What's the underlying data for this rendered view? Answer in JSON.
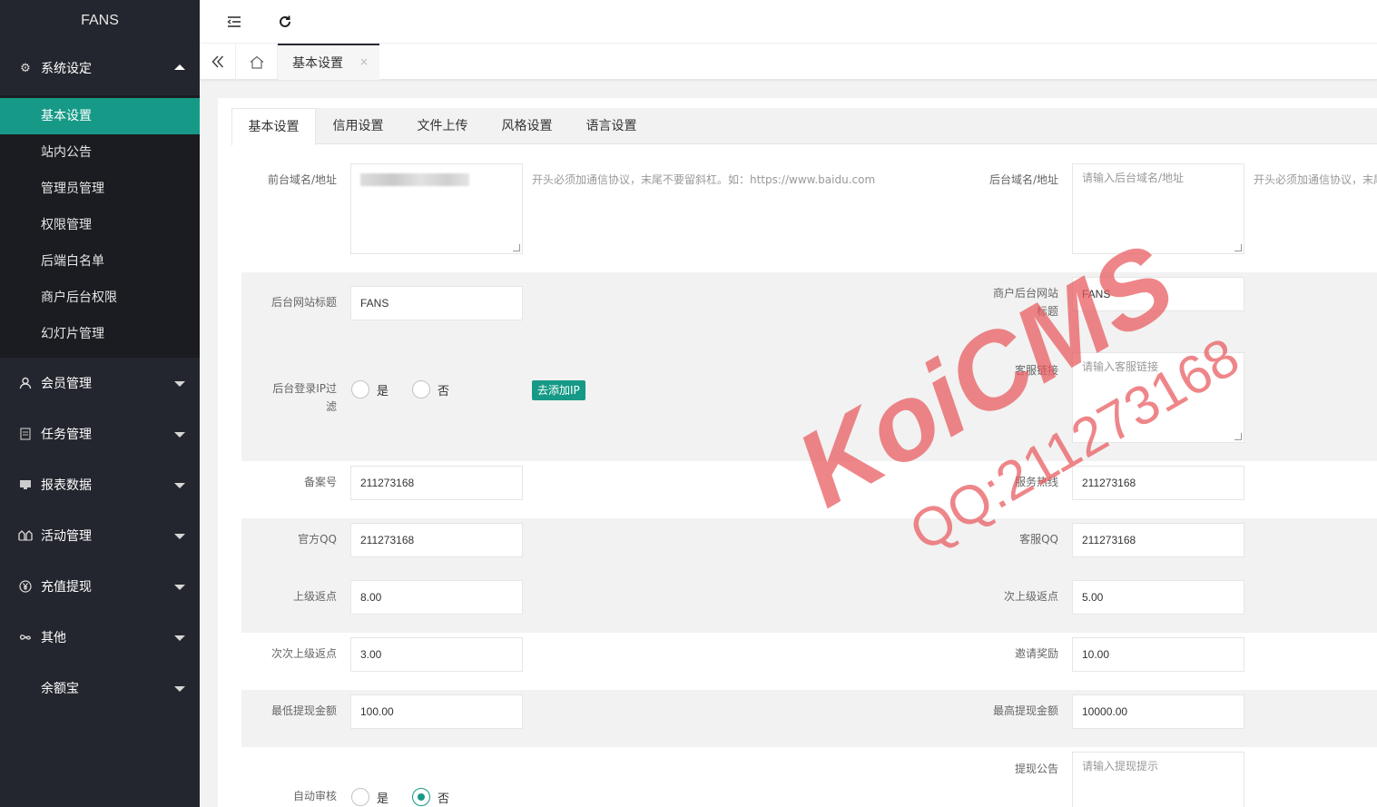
{
  "brand": "FANS",
  "sidebar": {
    "open_group": {
      "label": "系统设定",
      "icon": "gear-icon"
    },
    "sub_items": [
      {
        "label": "基本设置",
        "active": true
      },
      {
        "label": "站内公告"
      },
      {
        "label": "管理员管理"
      },
      {
        "label": "权限管理"
      },
      {
        "label": "后端白名单"
      },
      {
        "label": "商户后台权限"
      },
      {
        "label": "幻灯片管理"
      }
    ],
    "groups": [
      {
        "label": "会员管理",
        "icon": "user-icon"
      },
      {
        "label": "任务管理",
        "icon": "document-icon"
      },
      {
        "label": "报表数据",
        "icon": "chart-icon"
      },
      {
        "label": "活动管理",
        "icon": "group-icon"
      },
      {
        "label": "充值提现",
        "icon": "yen-icon"
      },
      {
        "label": "其他",
        "icon": "infinity-icon"
      },
      {
        "label": "余额宝",
        "icon": ""
      }
    ]
  },
  "topbar": {
    "menu_icon": "menu-toggle-icon",
    "refresh_icon": "refresh-icon"
  },
  "tabsbar": {
    "current_tab": "基本设置",
    "close": "×"
  },
  "form_tabs": [
    "基本设置",
    "信用设置",
    "文件上传",
    "风格设置",
    "语言设置"
  ],
  "form": {
    "front_domain": {
      "label": "前台域名/地址",
      "hint": "开头必须加通信协议，末尾不要留斜杠。如：https://www.baidu.com"
    },
    "back_domain": {
      "label": "后台域名/地址",
      "placeholder": "请输入后台域名/地址",
      "hint": "开头必须加通信协议，末尾"
    },
    "site_title": {
      "label": "后台网站标题",
      "value": "FANS"
    },
    "merchant_title": {
      "label_line1": "商户后台网站",
      "label_line2": "标题",
      "value": "FANS"
    },
    "ip_filter": {
      "label_line1": "后台登录IP过",
      "label_line2": "滤",
      "yes": "是",
      "no": "否",
      "add_button": "去添加IP"
    },
    "service_link": {
      "label": "客服链接",
      "placeholder": "请输入客服链接"
    },
    "icp": {
      "label": "备案号",
      "value": "211273168"
    },
    "hotline": {
      "label": "服务热线",
      "value": "211273168"
    },
    "official_qq": {
      "label": "官方QQ",
      "value": "211273168"
    },
    "service_qq": {
      "label": "客服QQ",
      "value": "211273168"
    },
    "rebate1": {
      "label": "上级返点",
      "value": "8.00"
    },
    "rebate2": {
      "label": "次上级返点",
      "value": "5.00"
    },
    "rebate3": {
      "label": "次次上级返点",
      "value": "3.00"
    },
    "invite": {
      "label": "邀请奖励",
      "value": "10.00"
    },
    "min_withdraw": {
      "label": "最低提现金额",
      "value": "100.00"
    },
    "max_withdraw": {
      "label": "最高提现金额",
      "value": "10000.00"
    },
    "withdraw_notice": {
      "label": "提现公告",
      "placeholder": "请输入提现提示"
    },
    "auto_review": {
      "label": "自动审核",
      "yes": "是",
      "no": "否"
    }
  },
  "watermark": {
    "line1": "KoiCMS",
    "line2": "QQ:211273168",
    "color": "#e8585c"
  }
}
